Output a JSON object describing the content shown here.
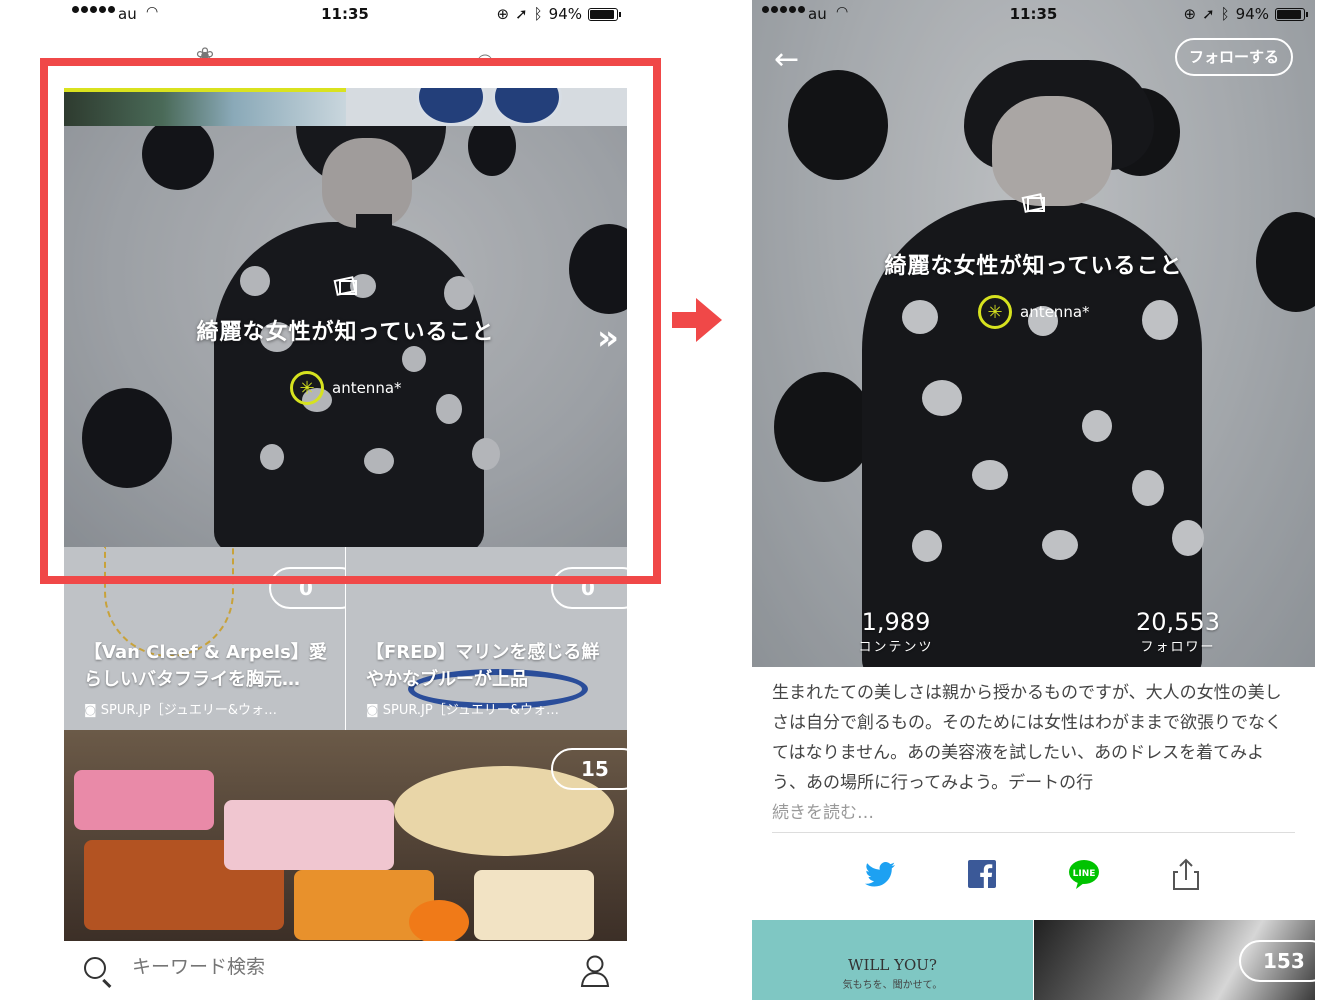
{
  "status_bar": {
    "carrier": "au",
    "time": "11:35",
    "battery": "94%"
  },
  "left_screen": {
    "top_tabs": [
      {
        "icon": "brain-icon"
      },
      {
        "icon": "book-icon"
      }
    ],
    "hero": {
      "title": "綺麗な女性が知っていること",
      "author": "antenna*"
    },
    "cards": [
      {
        "badge": "0",
        "title": "【Van Cleef & Arpels】愛らしいバタフライを胸元…",
        "source": "SPUR.JP［ジュエリー&ウォ…"
      },
      {
        "badge": "0",
        "title": "【FRED】マリンを感じる鮮やかなブルーが上品",
        "source": "SPUR.JP［ジュエリー&ウォ…"
      }
    ],
    "dessert_card": {
      "badge": "15"
    },
    "search": {
      "placeholder": "キーワード検索"
    }
  },
  "right_screen": {
    "follow_label": "フォローする",
    "hero": {
      "title": "綺麗な女性が知っていること",
      "author": "antenna*"
    },
    "stats": [
      {
        "value": "1,989",
        "label": "コンテンツ"
      },
      {
        "value": "20,553",
        "label": "フォロワー"
      }
    ],
    "description": "生まれたての美しさは親から授かるものですが、大人の女性の美しさは自分で創るもの。そのためには女性はわがままで欲張りでなくてはなりません。あの美容液を試したい、あのドレスを着てみよう、あの場所に行ってみよう。デートの行",
    "read_more": "続きを読む…",
    "share": [
      "twitter-icon",
      "facebook-icon",
      "line-icon",
      "share-icon"
    ],
    "line_label": "LINE",
    "bottom_cards": [
      {
        "title": "WILL YOU?",
        "subtitle": "気もちを、聞かせて。"
      },
      {
        "badge": "153"
      }
    ]
  },
  "colors": {
    "accent_red": "#f04848",
    "antenna_green": "#d6e21f",
    "twitter": "#1da1f2",
    "facebook": "#3b5998",
    "line": "#00c300"
  }
}
